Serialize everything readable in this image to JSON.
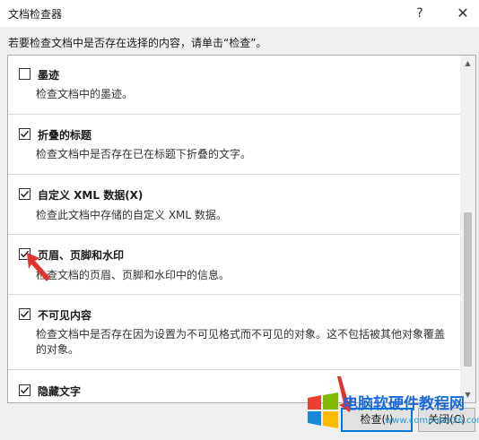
{
  "window": {
    "title": "文档检查器",
    "help_label": "?",
    "close_label": "✕"
  },
  "instruction": "若要检查文档中是否存在选择的内容，请单击“检查”。",
  "items": [
    {
      "label": "墨迹",
      "checked": false,
      "description": "检查文档中的墨迹。"
    },
    {
      "label": "折叠的标题",
      "checked": true,
      "description": "检查文档中是否存在已在标题下折叠的文字。"
    },
    {
      "label": "自定义 XML 数据(X)",
      "checked": true,
      "description": "检查此文档中存储的自定义 XML 数据。"
    },
    {
      "label": "页眉、页脚和水印",
      "checked": true,
      "description": "检查文档的页眉、页脚和水印中的信息。"
    },
    {
      "label": "不可见内容",
      "checked": true,
      "description": "检查文档中是否存在因为设置为不可见格式而不可见的对象。这不包括被其他对象覆盖的对象。"
    },
    {
      "label": "隐藏文字",
      "checked": true,
      "description": ""
    }
  ],
  "buttons": {
    "inspect_label": "检查(I)",
    "close_label": "关闭(C)"
  },
  "watermark": {
    "text": "电脑软硬件教程网",
    "url": "www.computer26.com"
  },
  "colors": {
    "accent": "#0078d7",
    "annotation_arrow": "#e0342f"
  }
}
